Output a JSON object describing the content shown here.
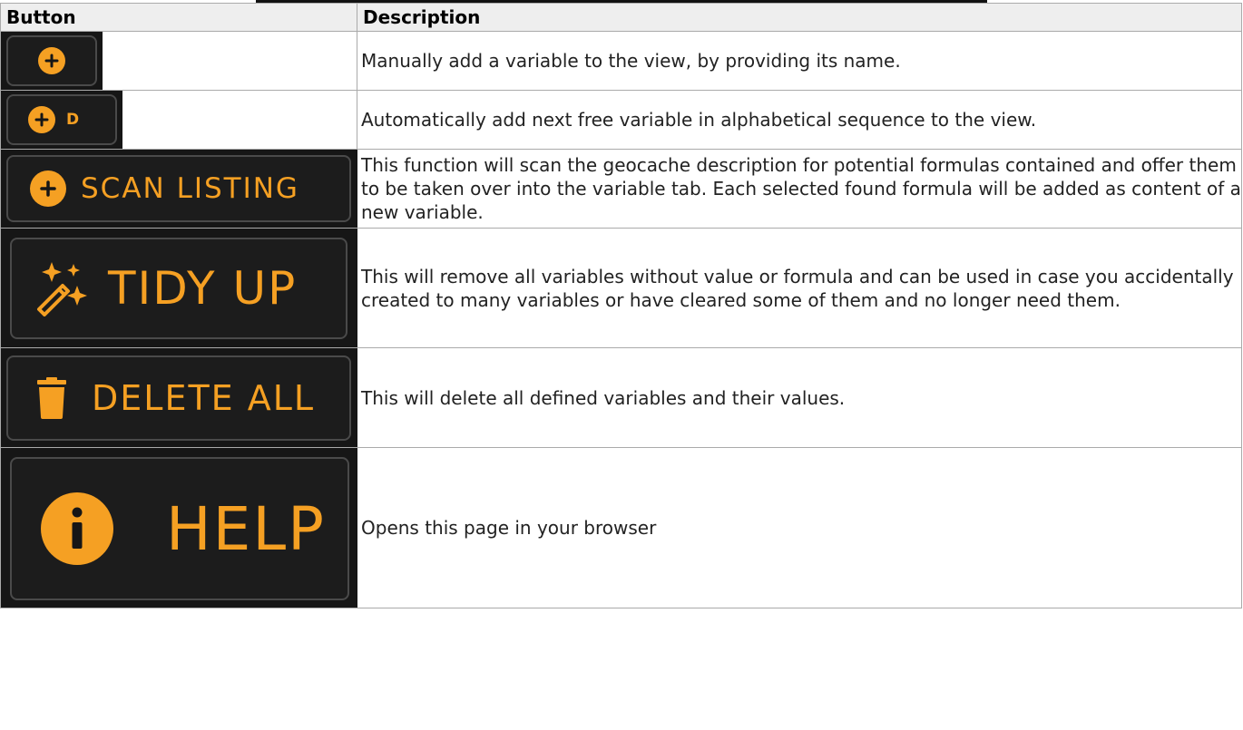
{
  "table": {
    "headers": {
      "button": "Button",
      "description": "Description"
    },
    "rows": [
      {
        "label": "",
        "icon": "plus-circle-icon",
        "description": "Manually add a variable to the view, by providing its name."
      },
      {
        "label": "D",
        "icon": "plus-circle-icon",
        "description": "Automatically add next free variable in alphabetical sequence to the view."
      },
      {
        "label": "SCAN LISTING",
        "icon": "plus-circle-icon",
        "description": "This function will scan the geocache description for potential formulas contained and offer them to be taken over into the variable tab. Each selected found formula will be added as content of a new variable."
      },
      {
        "label": "TIDY UP",
        "icon": "magic-wand-icon",
        "description": "This will remove all variables without value or formula and can be used in case you accidentally created to many variables or have cleared some of them and no longer need them."
      },
      {
        "label": "DELETE ALL",
        "icon": "trash-icon",
        "description": "This will delete all defined variables and their values."
      },
      {
        "label": "HELP",
        "icon": "info-circle-icon",
        "description": "Opens this page in your browser"
      }
    ]
  },
  "colors": {
    "accent": "#f5a023",
    "button_bg": "#1c1c1c",
    "button_border": "#4a4a4a"
  }
}
